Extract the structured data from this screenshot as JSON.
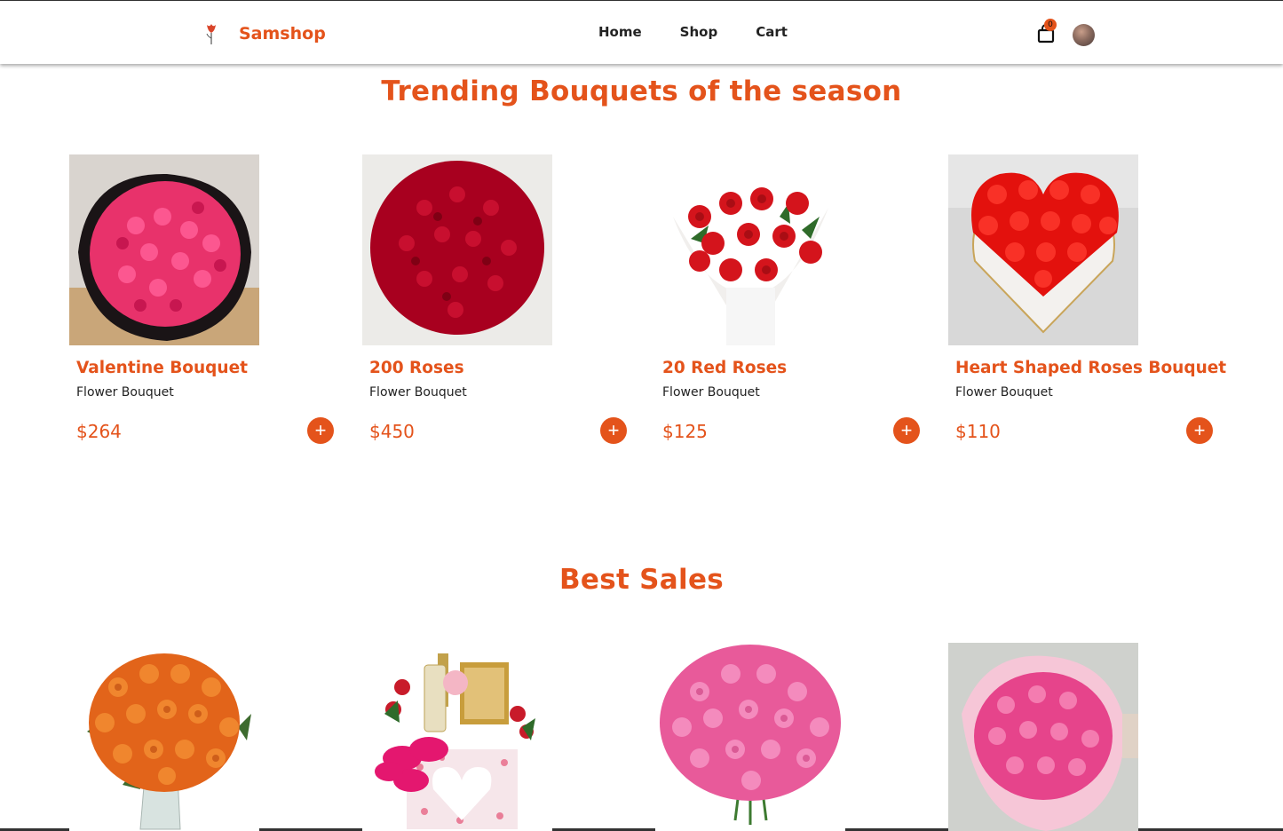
{
  "header": {
    "brand": "Samshop",
    "nav": [
      "Home",
      "Shop",
      "Cart"
    ],
    "cart_count": "0"
  },
  "trending": {
    "title": "Trending Bouquets of the season",
    "items": [
      {
        "name": "Valentine Bouquet",
        "category": "Flower Bouquet",
        "price": "$264"
      },
      {
        "name": "200 Roses",
        "category": "Flower Bouquet",
        "price": "$450"
      },
      {
        "name": "20 Red Roses",
        "category": "Flower Bouquet",
        "price": "$125"
      },
      {
        "name": "Heart Shaped Roses Bouquet",
        "category": "Flower Bouquet",
        "price": "$110"
      }
    ],
    "add_label": "+"
  },
  "best_sales": {
    "title": "Best Sales"
  },
  "colors": {
    "accent": "#e4531b"
  }
}
